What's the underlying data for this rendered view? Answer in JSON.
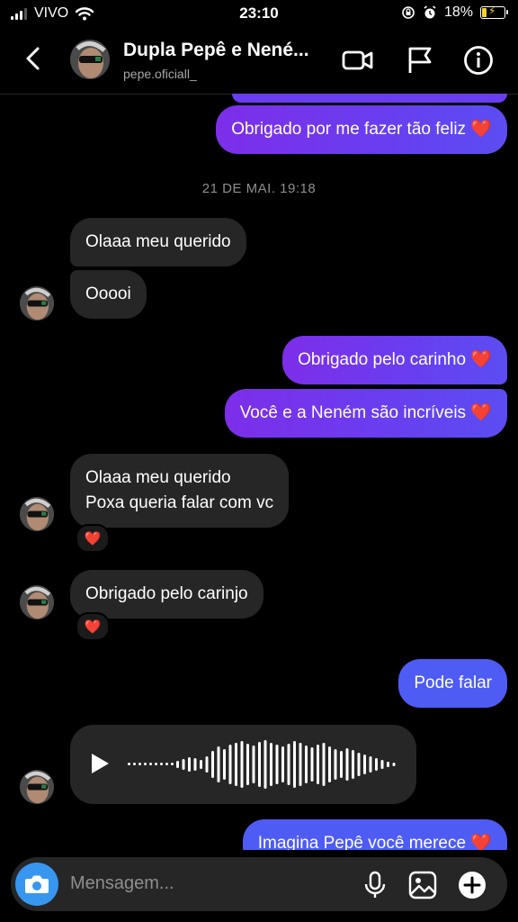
{
  "status_bar": {
    "carrier": "VIVO",
    "time": "23:10",
    "battery": "18%"
  },
  "header": {
    "title": "Dupla Pepê e Nené...",
    "username": "pepe.oficiall_",
    "icons": [
      "back-arrow-icon",
      "video-call-icon",
      "flag-icon",
      "info-icon"
    ]
  },
  "conversation": {
    "date_separator": "21 DE MAI. 19:18",
    "messages": [
      {
        "from": "me",
        "text": "Obrigado por me fazer tão feliz",
        "emoji": "❤️"
      },
      {
        "from": "them",
        "text": "Olaaa meu querido"
      },
      {
        "from": "them",
        "text": "Ooooi"
      },
      {
        "from": "me",
        "text": "Obrigado pelo carinho",
        "emoji": "❤️"
      },
      {
        "from": "me",
        "text": "Você e a Neném são incríveis",
        "emoji": "❤️"
      },
      {
        "from": "them",
        "lines": [
          "Olaaa meu querido",
          "Poxa queria falar com vc"
        ],
        "reaction": "❤️"
      },
      {
        "from": "them",
        "text": "Obrigado pelo carinjo",
        "reaction": "❤️"
      },
      {
        "from": "me",
        "text": "Pode falar"
      },
      {
        "from": "them",
        "type": "voice_message"
      },
      {
        "from": "me",
        "text": "Imagina Pepê você merece",
        "emoji": "❤️"
      }
    ]
  },
  "composer": {
    "placeholder": "Mensagem...",
    "icons": [
      "camera-icon",
      "microphone-icon",
      "gallery-icon",
      "plus-icon"
    ]
  },
  "colors": {
    "outgoing_bubble": "#6a3df0",
    "incoming_bubble": "#262626",
    "camera_button": "#3797f0",
    "heart": "#ff2d4f"
  }
}
